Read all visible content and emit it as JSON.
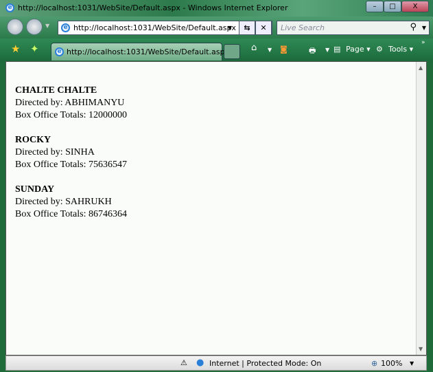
{
  "window": {
    "title": "http://localhost:1031/WebSite/Default.aspx - Windows Internet Explorer"
  },
  "address": {
    "url": "http://localhost:1031/WebSite/Default.aspx"
  },
  "search": {
    "placeholder": "Live Search"
  },
  "tab": {
    "label": "http://localhost:1031/WebSite/Default.aspx"
  },
  "commands": {
    "page": "Page",
    "tools": "Tools"
  },
  "movies": [
    {
      "title": "CHALTE CHALTE",
      "director": "Directed by: ABHIMANYU",
      "box": "Box Office Totals: 12000000"
    },
    {
      "title": "ROCKY",
      "director": "Directed by: SINHA",
      "box": "Box Office Totals: 75636547"
    },
    {
      "title": "SUNDAY",
      "director": "Directed by: SAHRUKH",
      "box": "Box Office Totals: 86746364"
    }
  ],
  "status": {
    "zone": "Internet | Protected Mode: On",
    "zoom": "100%"
  }
}
